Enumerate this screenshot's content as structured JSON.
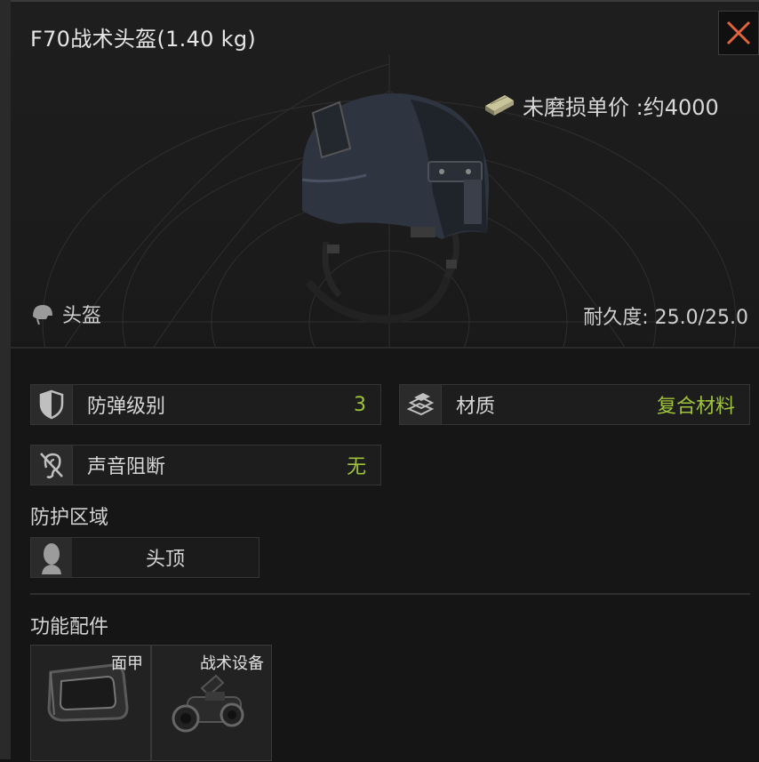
{
  "window": {
    "title": "F70战术头盔(1.40 kg)",
    "close_icon": "close-icon",
    "accent_color": "#e0643c"
  },
  "preview": {
    "item_image": "tactical-helmet-image",
    "price_label": "未磨损单价 :约4000",
    "price_icon": "money-stack-icon",
    "category_label": "头盔",
    "category_icon": "helmet-icon",
    "durability_label": "耐久度: 25.0/25.0"
  },
  "stats": [
    {
      "label": "防弹级别",
      "value": "3",
      "icon": "shield-icon"
    },
    {
      "label": "材质",
      "value": "复合材料",
      "icon": "material-icon"
    },
    {
      "label": "声音阻断",
      "value": "无",
      "icon": "ear-blocked-icon"
    }
  ],
  "value_color": "#9fc33a",
  "protection": {
    "title": "防护区域",
    "zones": [
      {
        "label": "头顶",
        "icon": "head-silhouette-icon"
      }
    ]
  },
  "attachments": {
    "title": "功能配件",
    "slots": [
      {
        "label": "面甲",
        "icon": "visor-icon"
      },
      {
        "label": "战术设备",
        "icon": "night-vision-icon"
      }
    ]
  }
}
